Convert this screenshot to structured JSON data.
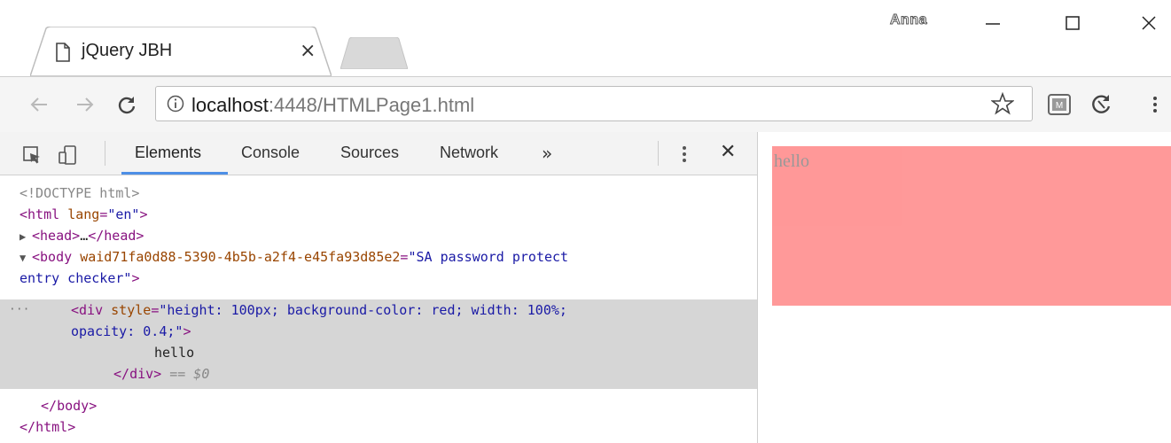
{
  "window": {
    "profile_name": "Anna",
    "tab": {
      "title": "jQuery JBH",
      "close_glyph": "×"
    },
    "controls": {
      "minimize": "—",
      "close": "✕"
    }
  },
  "toolbar": {
    "url_host": "localhost",
    "url_rest": ":4448/HTMLPage1.html"
  },
  "devtools": {
    "tabs": [
      {
        "label": "Elements",
        "active": true
      },
      {
        "label": "Console",
        "active": false
      },
      {
        "label": "Sources",
        "active": false
      },
      {
        "label": "Network",
        "active": false
      }
    ],
    "overflow_glyph": "»",
    "close_glyph": "✕",
    "dom": {
      "doctype": "<!DOCTYPE html>",
      "html_open_tag": "html",
      "html_lang_attr": "lang",
      "html_lang_val": "\"en\"",
      "head_collapsed": "head",
      "head_ellipsis": "…",
      "body_tag": "body",
      "body_attr": "waid71fa0d88-5390-4b5b-a2f4-e45fa93d85e2",
      "body_val_1": "\"SA password protect",
      "body_val_2": "entry checker\"",
      "div_tag": "div",
      "div_style_attr": "style",
      "div_style_val_1": "\"height: 100px; background-color: red; width: 100%;",
      "div_style_val_2": "opacity: 0.4;\"",
      "div_text": "hello",
      "div_close": "div",
      "selected_marker": "== $0",
      "body_close": "body",
      "html_close": "html",
      "gutter_dots": "···"
    }
  },
  "viewport": {
    "div_text": "hello",
    "div_color": "#ff0000",
    "div_opacity": 0.4
  }
}
